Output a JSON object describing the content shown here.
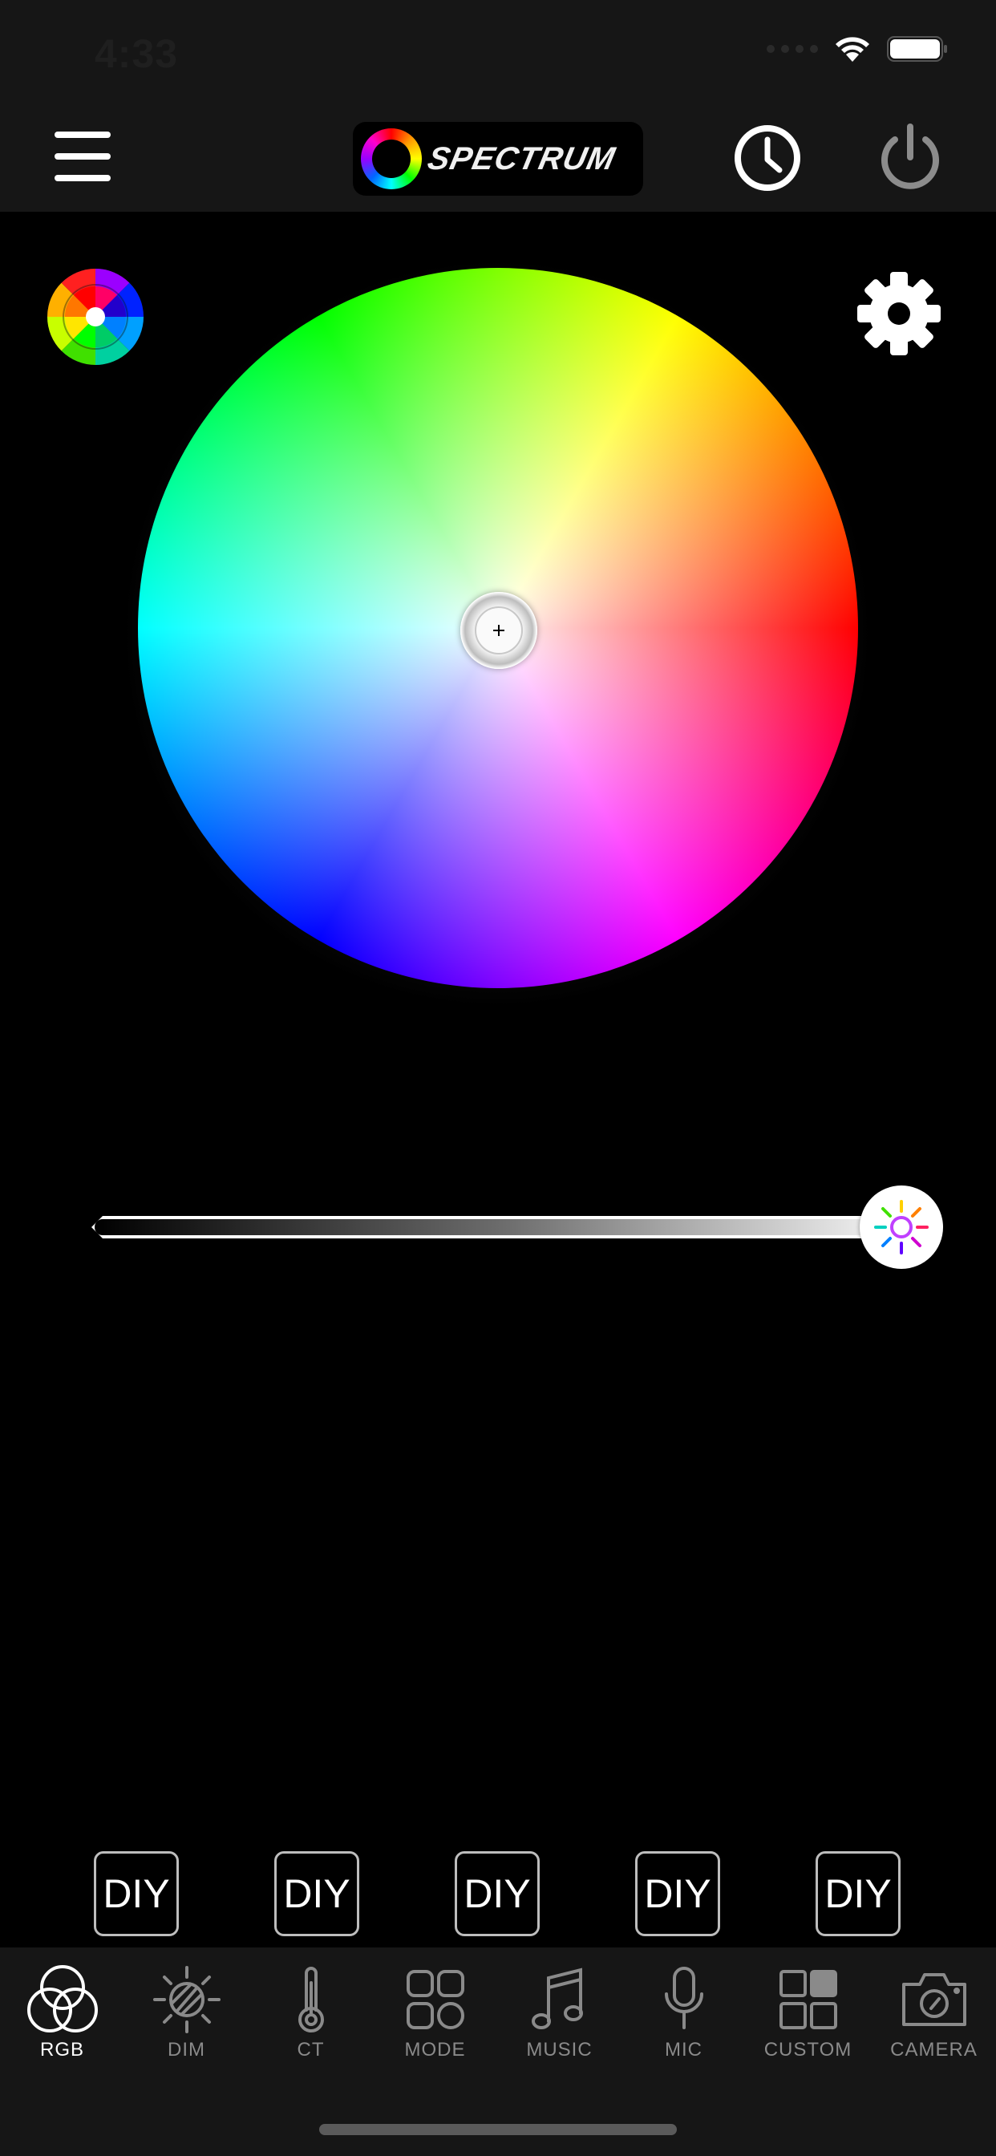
{
  "status_bar": {
    "time": "4:33"
  },
  "nav": {
    "logo_text": "SPECTRUM"
  },
  "brightness": {
    "level": 1.0
  },
  "color_picker": {
    "selected_hue": "white"
  },
  "diy_buttons": [
    {
      "label": "DIY"
    },
    {
      "label": "DIY"
    },
    {
      "label": "DIY"
    },
    {
      "label": "DIY"
    },
    {
      "label": "DIY"
    }
  ],
  "tabs": [
    {
      "label": "RGB",
      "icon": "rgb-circles-icon",
      "active": true
    },
    {
      "label": "DIM",
      "icon": "dim-icon",
      "active": false
    },
    {
      "label": "CT",
      "icon": "thermometer-icon",
      "active": false
    },
    {
      "label": "MODE",
      "icon": "mode-grid-icon",
      "active": false
    },
    {
      "label": "MUSIC",
      "icon": "music-note-icon",
      "active": false
    },
    {
      "label": "MIC",
      "icon": "microphone-icon",
      "active": false
    },
    {
      "label": "CUSTOM",
      "icon": "custom-grid-icon",
      "active": false
    },
    {
      "label": "CAMERA",
      "icon": "camera-icon",
      "active": false
    }
  ],
  "colors": {
    "header_bg": "#161616",
    "page_bg": "#000000",
    "tab_inactive": "#8a8a8a",
    "tab_active": "#ffffff"
  }
}
